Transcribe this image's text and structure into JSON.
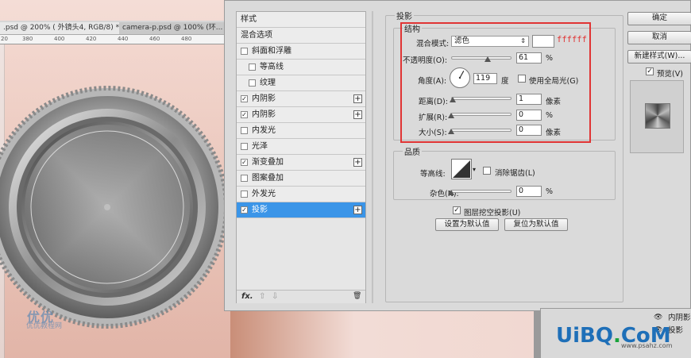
{
  "document_tabs": [
    {
      "label": ".psd @ 200% ( 外镜头4, RGB/8) *",
      "close": "×"
    },
    {
      "label": "camera-p.psd @ 100% (环...",
      "close": "×"
    }
  ],
  "ruler_marks": [
    "20",
    "380",
    "400",
    "420",
    "440",
    "460",
    "480"
  ],
  "canvas_watermark": {
    "logo": "优优",
    "text": "优优教程网"
  },
  "style_list": [
    {
      "label": "样式",
      "checkbox": false,
      "checked": false,
      "plus": false,
      "indent": 0,
      "selected": false
    },
    {
      "label": "混合选项",
      "checkbox": false,
      "checked": false,
      "plus": false,
      "indent": 0,
      "selected": false
    },
    {
      "label": "斜面和浮雕",
      "checkbox": true,
      "checked": false,
      "plus": false,
      "indent": 0,
      "selected": false
    },
    {
      "label": "等高线",
      "checkbox": true,
      "checked": false,
      "plus": false,
      "indent": 1,
      "selected": false
    },
    {
      "label": "纹理",
      "checkbox": true,
      "checked": false,
      "plus": false,
      "indent": 1,
      "selected": false
    },
    {
      "label": "内阴影",
      "checkbox": true,
      "checked": true,
      "plus": true,
      "indent": 0,
      "selected": false
    },
    {
      "label": "内阴影",
      "checkbox": true,
      "checked": true,
      "plus": true,
      "indent": 0,
      "selected": false
    },
    {
      "label": "内发光",
      "checkbox": true,
      "checked": false,
      "plus": false,
      "indent": 0,
      "selected": false
    },
    {
      "label": "光泽",
      "checkbox": true,
      "checked": false,
      "plus": false,
      "indent": 0,
      "selected": false
    },
    {
      "label": "渐变叠加",
      "checkbox": true,
      "checked": true,
      "plus": true,
      "indent": 0,
      "selected": false
    },
    {
      "label": "图案叠加",
      "checkbox": true,
      "checked": false,
      "plus": false,
      "indent": 0,
      "selected": false
    },
    {
      "label": "外发光",
      "checkbox": true,
      "checked": false,
      "plus": false,
      "indent": 0,
      "selected": false
    },
    {
      "label": "投影",
      "checkbox": true,
      "checked": true,
      "plus": true,
      "indent": 0,
      "selected": true
    }
  ],
  "list_footer": {
    "fx": "fx.",
    "up": "⇧",
    "down": "⇩",
    "trash": "🗑"
  },
  "drop_shadow": {
    "title": "投影",
    "structure": {
      "title": "结构",
      "blend_mode_label": "混合模式:",
      "blend_mode_value": "滤色",
      "color_hex_note": "ffffff",
      "opacity_label": "不透明度(O):",
      "opacity_value": "61",
      "opacity_unit": "%",
      "opacity_fraction": 0.61,
      "angle_label": "角度(A):",
      "angle_value": "119",
      "angle_unit": "度",
      "global_light_label": "使用全局光(G)",
      "global_light_checked": false,
      "distance_label": "距离(D):",
      "distance_value": "1",
      "distance_unit": "像素",
      "spread_label": "扩展(R):",
      "spread_value": "0",
      "spread_unit": "%",
      "size_label": "大小(S):",
      "size_value": "0",
      "size_unit": "像素"
    },
    "quality": {
      "title": "品质",
      "contour_label": "等高线:",
      "antialias_label": "消除锯齿(L)",
      "antialias_checked": false,
      "noise_label": "杂色(N):",
      "noise_value": "0",
      "noise_unit": "%"
    },
    "knockout_label": "图层挖空投影(U)",
    "knockout_checked": true,
    "make_default_label": "设置为默认值",
    "reset_default_label": "复位为默认值"
  },
  "right_buttons": {
    "ok": "确定",
    "cancel": "取消",
    "new_style": "新建样式(W)...",
    "preview_label": "预览(V)",
    "preview_checked": true
  },
  "layers_panel": {
    "rows": [
      {
        "eye": "👁",
        "label": "内阴影"
      },
      {
        "eye": "👁",
        "label": "投影"
      }
    ]
  },
  "site_watermark": {
    "part1": "UiBQ",
    "part2": ".",
    "part3": "CoM",
    "url": "www.psahz.com"
  },
  "colors": {
    "accent_selected": "#3b95e8",
    "highlight_box": "#e03434",
    "dialog_bg": "#dadada"
  }
}
